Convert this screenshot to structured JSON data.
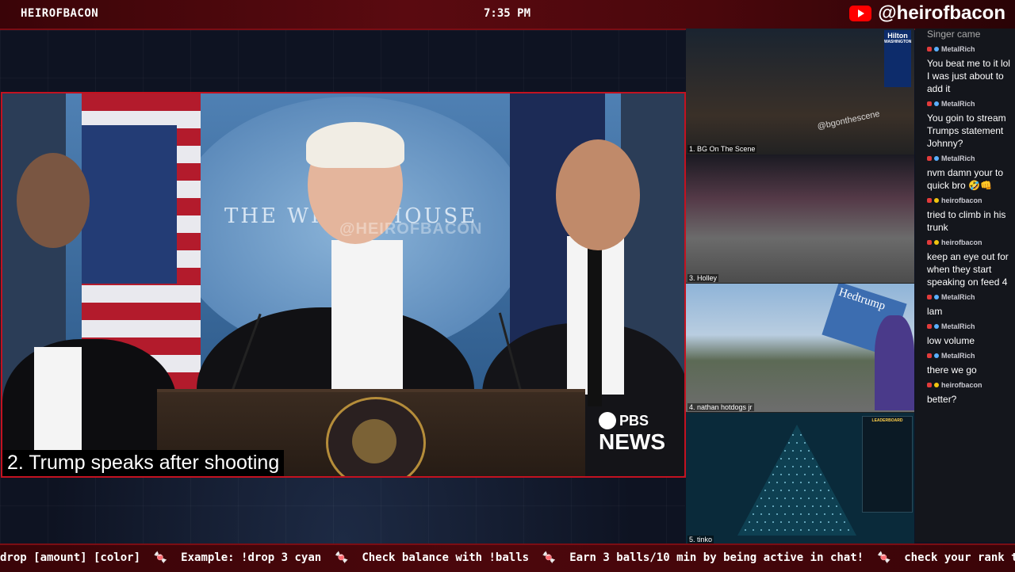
{
  "topbar": {
    "name": "HEIROFBACON",
    "time": "7:35 PM",
    "handle": "@heirofbacon",
    "handle_icon": "youtube-icon"
  },
  "main_feed": {
    "caption": "2. Trump speaks after shooting",
    "watermark": "@HEIROFBACON",
    "backdrop_text": "THE WHITE HOUSE",
    "network_line1": "PBS",
    "network_line2": "NEWS"
  },
  "feeds": [
    {
      "label": "1. BG On The Scene",
      "watermark": "@bgonthescene",
      "sign_top": "Hilton",
      "sign_mid": "WASHINGTON"
    },
    {
      "label": "3. Holley"
    },
    {
      "label": "4. nathan hotdogs jr",
      "sign_text": "Hedtrump"
    },
    {
      "label": "5. tinko",
      "leaderboard_title": "LEADERBOARD"
    }
  ],
  "chat": {
    "messages": [
      {
        "user": "",
        "text": "Singer came"
      },
      {
        "user": "MetalRich",
        "text": "You beat me to it lol I was just about to add it"
      },
      {
        "user": "MetalRich",
        "text": "You goin to stream Trumps statement Johnny?"
      },
      {
        "user": "MetalRich",
        "text": "nvm damn your to quick bro 🤣👊"
      },
      {
        "user": "heirofbacon",
        "text": "tried to climb in his trunk"
      },
      {
        "user": "heirofbacon",
        "text": "keep an eye out for when they start speaking on feed 4"
      },
      {
        "user": "MetalRich",
        "text": "lam"
      },
      {
        "user": "MetalRich",
        "text": "low volume"
      },
      {
        "user": "MetalRich",
        "text": "there we go"
      },
      {
        "user": "heirofbacon",
        "text": "better?"
      }
    ]
  },
  "ticker": {
    "items": [
      "drop [amount] [color]",
      "Example: !drop 3 cyan",
      "Check balance with !balls",
      "Earn 3 balls/10 min by being active in chat!",
      "check your rank ty"
    ],
    "separator": "🍬"
  }
}
